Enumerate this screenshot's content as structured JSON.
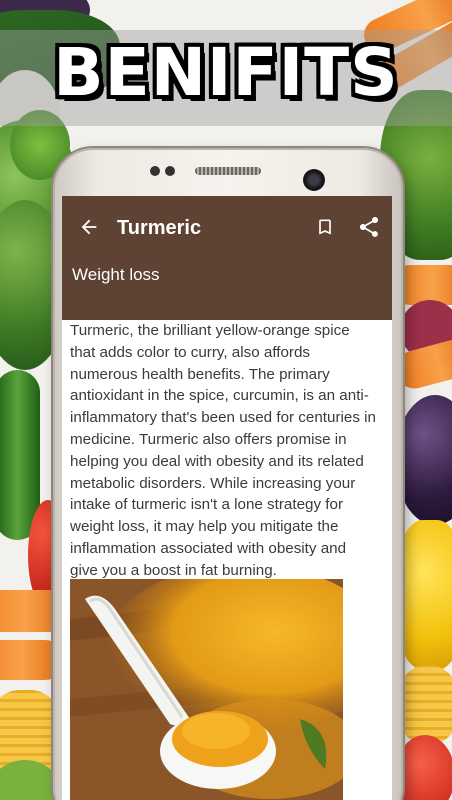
{
  "banner": {
    "title": "BENIFITS"
  },
  "app": {
    "title": "Turmeric",
    "subtitle": "Weight loss",
    "body": "Turmeric, the brilliant yellow-orange spice that adds color to curry, also affords numerous health benefits. The primary antioxidant in the spice, curcumin, is an anti-inflammatory that's been used for centuries in medicine. Turmeric also offers promise in helping you deal with obesity and its related metabolic disorders. While increasing your intake of turmeric isn't a lone strategy for weight loss, it may help you mitigate the inflammation associated with obesity and give you a boost in fat burning."
  },
  "icons": {
    "back": "arrow-back-icon",
    "bookmark": "bookmark-icon",
    "share": "share-icon"
  },
  "colors": {
    "appbar": "#5e4234",
    "banner_text": "#ffffff",
    "turmeric": "#e9a21b"
  }
}
